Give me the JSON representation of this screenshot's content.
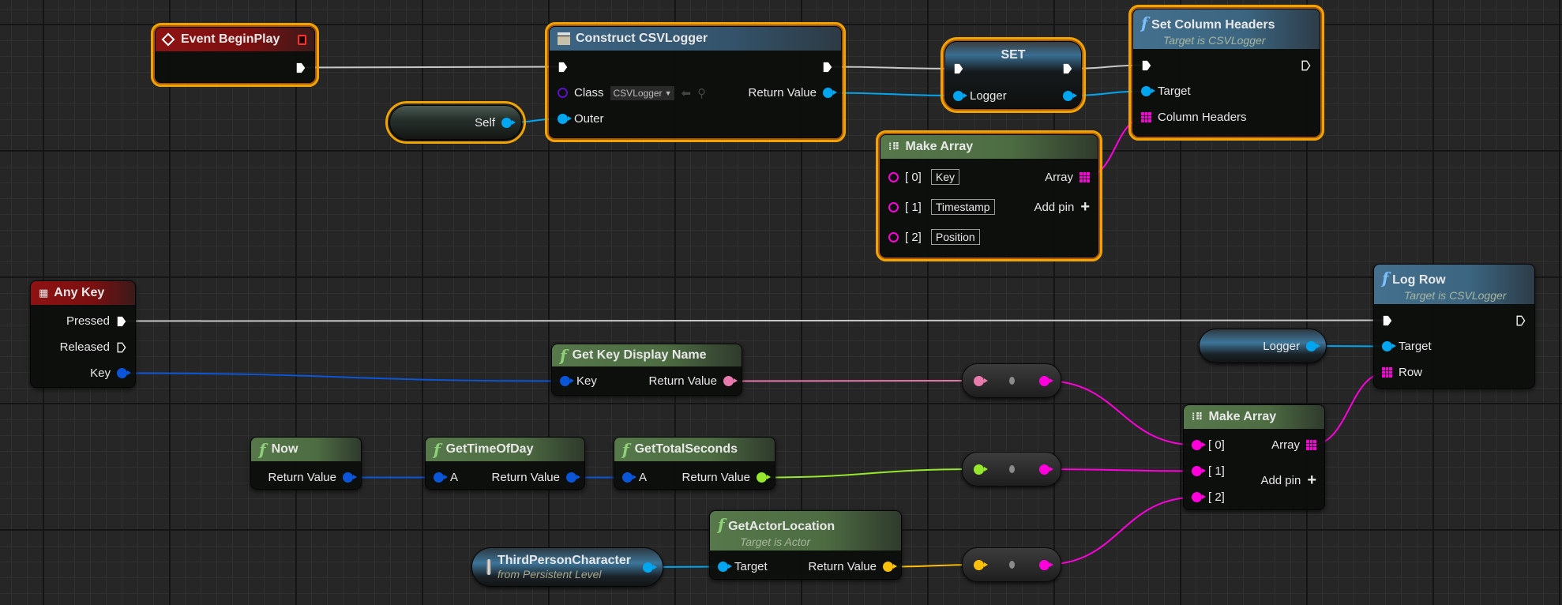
{
  "colors": {
    "exec": "#ffffff",
    "object": "#00a6f0",
    "key_struct": "#0b55d8",
    "string": "#e87aae",
    "array": "#ff00dc",
    "float": "#95e82c",
    "vector": "#fcbf0c",
    "class": "#5a10c8",
    "selection": "#f1a400"
  },
  "event_begin_play": {
    "title": "Event BeginPlay",
    "icon": "event-diamond-icon"
  },
  "construct": {
    "title": "Construct CSVLogger",
    "class_label": "Class",
    "class_value": "CSVLogger",
    "outer_label": "Outer",
    "return_label": "Return Value"
  },
  "self_node": {
    "label": "Self"
  },
  "set_node": {
    "title": "SET",
    "logger_label": "Logger"
  },
  "set_column_headers": {
    "title": "Set Column Headers",
    "subtitle": "Target is CSVLogger",
    "target_label": "Target",
    "headers_label": "Column Headers"
  },
  "make_array_top": {
    "title": "Make Array",
    "items": [
      {
        "index": "[ 0]",
        "value": "Key"
      },
      {
        "index": "[ 1]",
        "value": "Timestamp"
      },
      {
        "index": "[ 2]",
        "value": "Position"
      }
    ],
    "array_label": "Array",
    "add_pin_label": "Add pin"
  },
  "any_key": {
    "title": "Any Key",
    "pressed": "Pressed",
    "released": "Released",
    "key": "Key"
  },
  "log_row": {
    "title": "Log Row",
    "subtitle": "Target is CSVLogger",
    "target_label": "Target",
    "row_label": "Row"
  },
  "logger_getter": {
    "label": "Logger"
  },
  "get_key_display_name": {
    "title": "Get Key Display Name",
    "key_label": "Key",
    "return_label": "Return Value"
  },
  "make_array_bottom": {
    "title": "Make Array",
    "items": [
      "[ 0]",
      "[ 1]",
      "[ 2]"
    ],
    "array_label": "Array",
    "add_pin_label": "Add pin"
  },
  "now": {
    "title": "Now",
    "return_label": "Return Value"
  },
  "get_time_of_day": {
    "title": "GetTimeOfDay",
    "a_label": "A",
    "return_label": "Return Value"
  },
  "get_total_seconds": {
    "title": "GetTotalSeconds",
    "a_label": "A",
    "return_label": "Return Value"
  },
  "get_actor_location": {
    "title": "GetActorLocation",
    "subtitle": "Target is Actor",
    "target_label": "Target",
    "return_label": "Return Value"
  },
  "third_person": {
    "title": "ThirdPersonCharacter",
    "subtitle": "from Persistent Level"
  }
}
